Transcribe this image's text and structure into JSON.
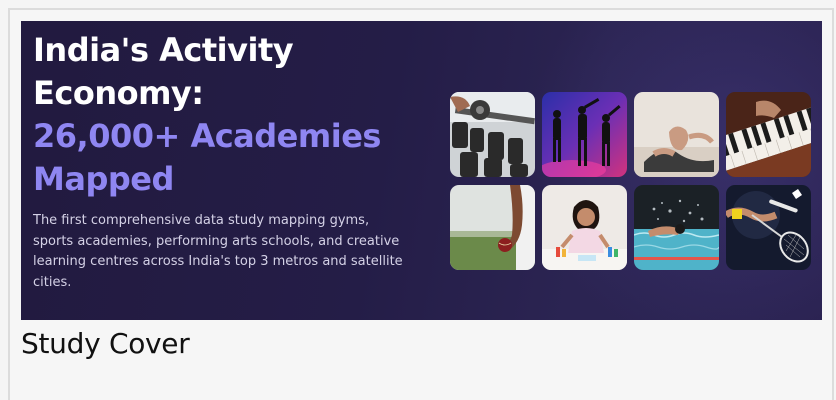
{
  "banner": {
    "headline_line1": "India's Activity",
    "headline_line2": "Economy:",
    "headline_accent_line1": "26,000+ Academies",
    "headline_accent_line2": "Mapped",
    "description": "The first comprehensive data study mapping gyms, sports academies, performing arts schools, and creative learning centres across India's top 3 metros and satellite cities.",
    "accent_color": "#8f86f2",
    "background_color": "#241d47",
    "tiles": [
      {
        "name": "gym-dumbbells-photo"
      },
      {
        "name": "dance-performance-photo"
      },
      {
        "name": "yoga-photo"
      },
      {
        "name": "piano-keys-photo"
      },
      {
        "name": "cricket-ball-photo"
      },
      {
        "name": "child-painting-photo"
      },
      {
        "name": "swimming-photo"
      },
      {
        "name": "badminton-photo"
      }
    ]
  },
  "caption": "Study Cover"
}
